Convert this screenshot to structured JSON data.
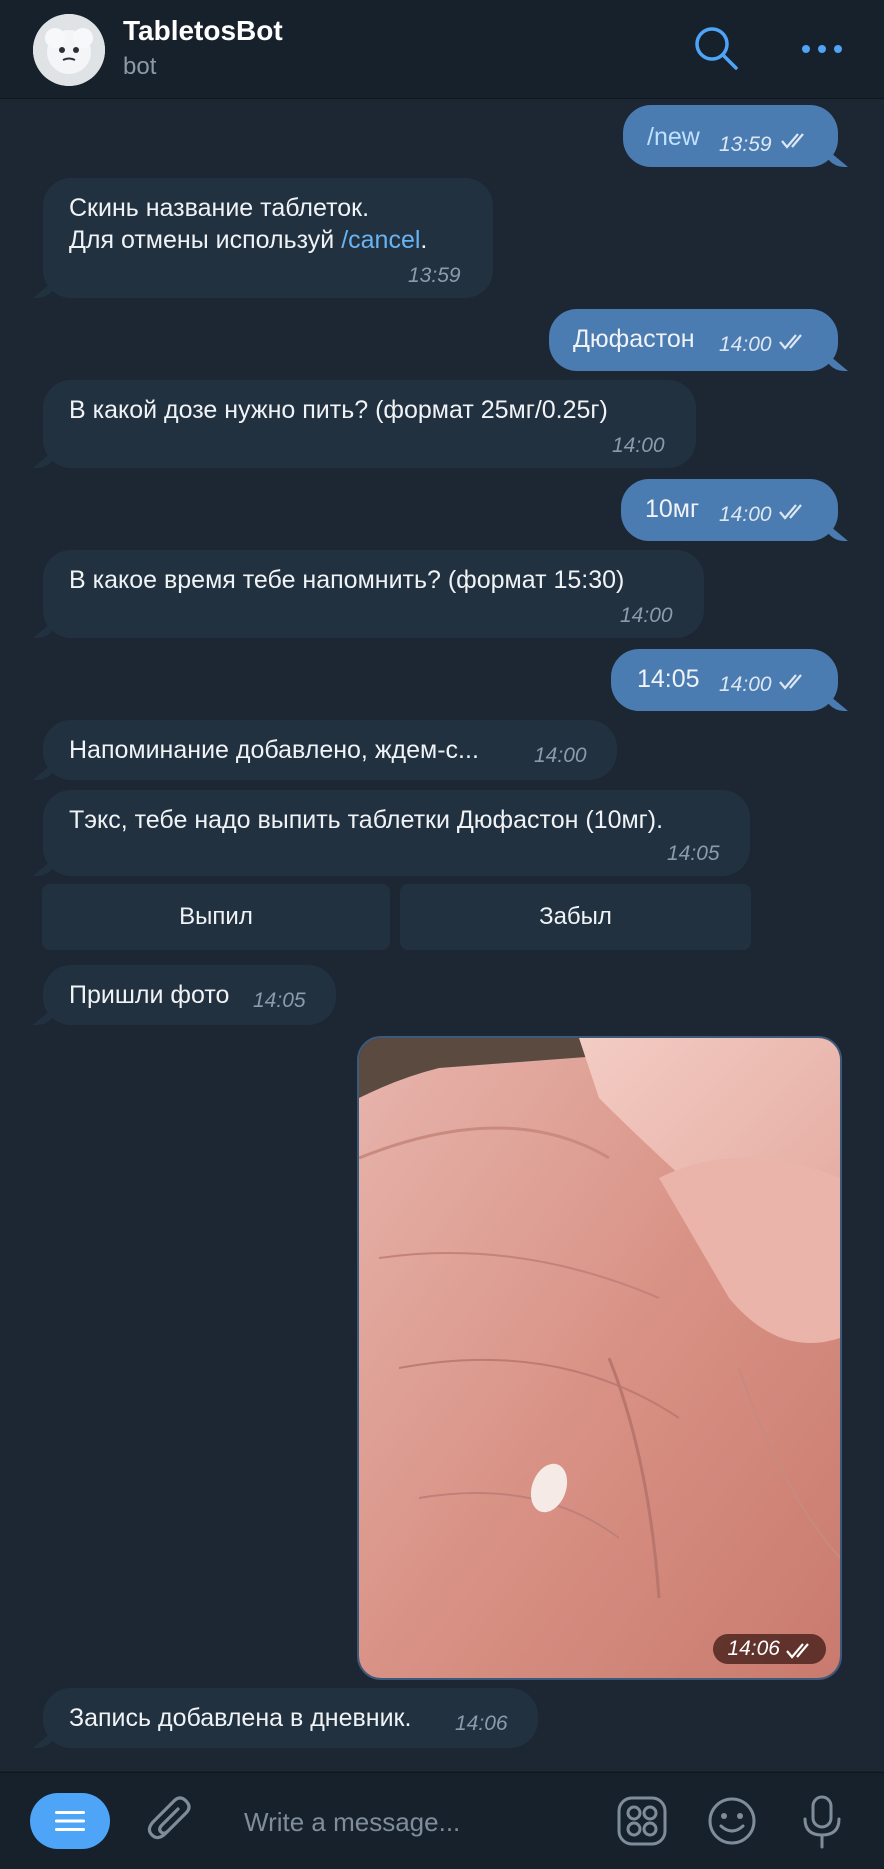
{
  "header": {
    "title": "TabletosBot",
    "subtitle": "bot"
  },
  "messages": [
    {
      "dir": "out",
      "text": "/new",
      "time": "13:59"
    },
    {
      "dir": "in",
      "line1": "Скинь название таблеток.",
      "line2_prefix": "Для отмены используй ",
      "line2_link": "/cancel",
      "line2_suffix": ".",
      "time": "13:59"
    },
    {
      "dir": "out",
      "text": "Дюфастон",
      "time": "14:00"
    },
    {
      "dir": "in",
      "text": "В какой дозе нужно пить? (формат 25мг/0.25г)",
      "time": "14:00"
    },
    {
      "dir": "out",
      "text": "10мг",
      "time": "14:00"
    },
    {
      "dir": "in",
      "text": "В какое время тебе напомнить? (формат 15:30)",
      "time": "14:00"
    },
    {
      "dir": "out",
      "text": "14:05",
      "time": "14:00"
    },
    {
      "dir": "in",
      "text": "Напоминание добавлено, ждем-с...",
      "time": "14:00"
    },
    {
      "dir": "in",
      "text": "Тэкс, тебе надо выпить таблетки Дюфастон (10мг).",
      "time": "14:05"
    },
    {
      "dir": "in",
      "text": "Пришли фото",
      "time": "14:05"
    },
    {
      "dir": "out",
      "type": "photo",
      "time": "14:06"
    },
    {
      "dir": "in",
      "text": "Запись добавлена в дневник.",
      "time": "14:06"
    }
  ],
  "keyboard": {
    "buttons": [
      "Выпил",
      "Забыл"
    ]
  },
  "composer": {
    "placeholder": "Write a message..."
  },
  "colors": {
    "accent": "#4ea4f6",
    "outgoing_bubble": "#4a7bb1",
    "incoming_bubble": "#223140",
    "background": "#1c2733"
  },
  "icons": [
    "search-icon",
    "more-icon",
    "menu-icon",
    "attach-icon",
    "stickers-icon",
    "emoji-icon",
    "microphone-icon",
    "double-check-icon"
  ]
}
